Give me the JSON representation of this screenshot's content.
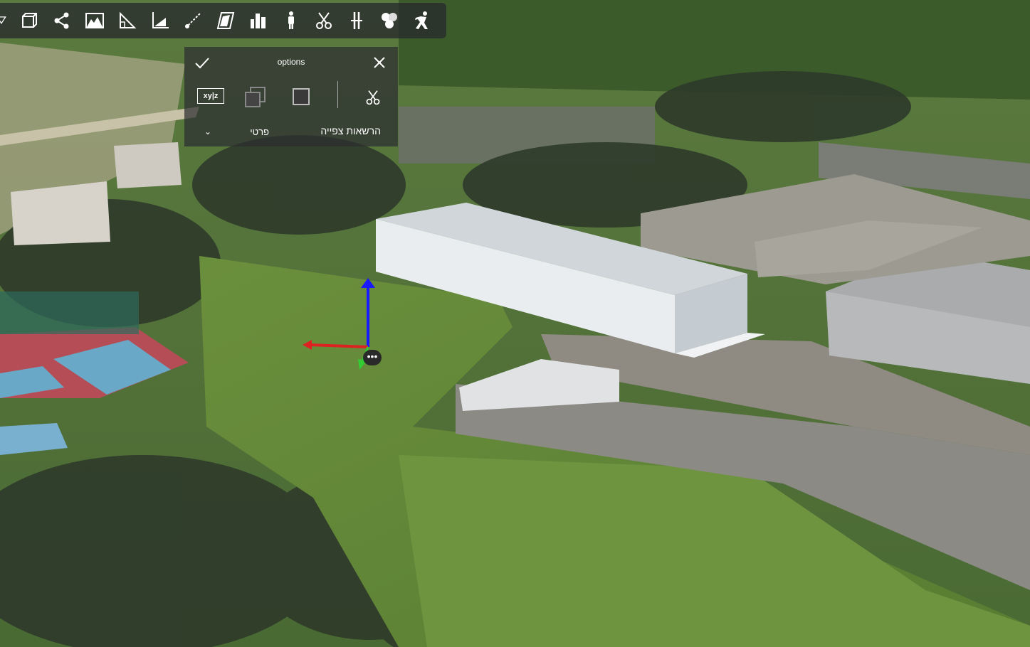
{
  "toolbar": {
    "tools": [
      {
        "name": "filter-icon"
      },
      {
        "name": "box-icon"
      },
      {
        "name": "share-icon"
      },
      {
        "name": "terrain-profile-icon"
      },
      {
        "name": "angle-measure-icon"
      },
      {
        "name": "slope-icon"
      },
      {
        "name": "line-of-sight-icon"
      },
      {
        "name": "area-measure-icon"
      },
      {
        "name": "buildings-icon"
      },
      {
        "name": "person-icon"
      },
      {
        "name": "scissors-icon"
      },
      {
        "name": "split-vertical-icon"
      },
      {
        "name": "circles-icon"
      },
      {
        "name": "walk-icon"
      }
    ]
  },
  "options_panel": {
    "title": "options",
    "coord_label": "xy|z",
    "permission_label": "הרשאות צפייה",
    "permission_value": "פרטי"
  },
  "colors": {
    "toolbar_bg": "#2b2d2f",
    "axis_z": "#1a1aff",
    "axis_x": "#dd2222",
    "axis_y": "#33cc33",
    "box_fill": "#e6ebee"
  }
}
